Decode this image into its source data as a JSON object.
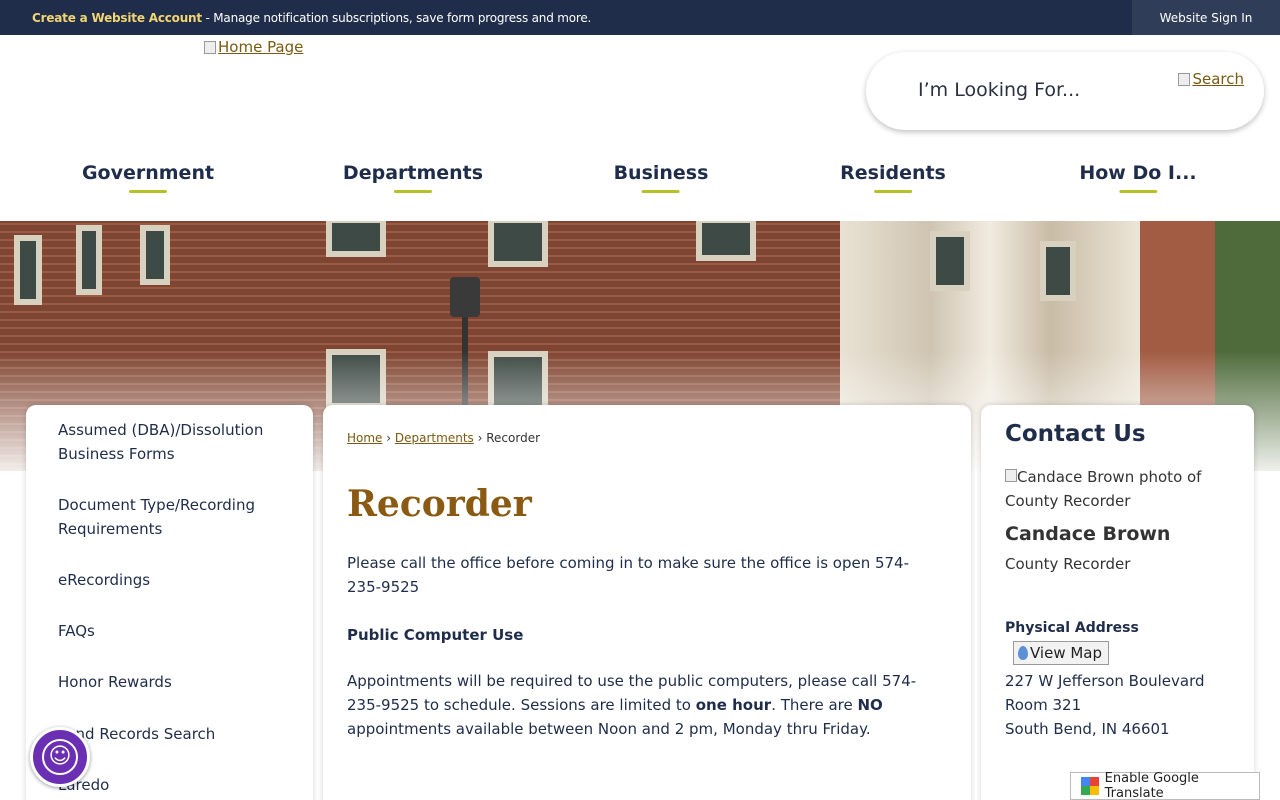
{
  "topbar": {
    "create_label": "Create a Website Account",
    "message": " - Manage notification subscriptions, save form progress and more.",
    "signin_label": "Website Sign In"
  },
  "header": {
    "home_link": "Home Page",
    "search_placeholder": "I’m Looking For...",
    "search_button": "Search"
  },
  "nav": {
    "items": [
      "Government",
      "Departments",
      "Business",
      "Residents",
      "How Do I..."
    ]
  },
  "sidebar": {
    "items": [
      "Assumed (DBA)/Dissolution Business Forms",
      "Document Type/Recording Requirements",
      "eRecordings",
      "FAQs",
      "Honor Rewards",
      "Land Records Search",
      "Laredo"
    ]
  },
  "breadcrumb": {
    "home": "Home",
    "departments": "Departments",
    "current": "Recorder",
    "sep": "›"
  },
  "main": {
    "title": "Recorder",
    "para1": "Please call the office before coming in to make sure the office is open 574-235-9525",
    "heading": "Public Computer Use",
    "para2_a": "Appointments will be required to use the public computers, please call 574-235-9525 to schedule. Sessions are limited to ",
    "para2_b": "one hour",
    "para2_c": ".  There are ",
    "para2_d": "NO",
    "para2_e": " appointments available between Noon and 2 pm, Monday thru Friday."
  },
  "contact": {
    "title": "Contact Us",
    "photo_alt": "Candace Brown photo of County Recorder",
    "name": "Candace Brown",
    "role": "County Recorder",
    "address_label": "Physical Address",
    "map_button": "View Map",
    "address_line1": "227 W Jefferson Boulevard",
    "address_line2": "Room 321",
    "address_line3": "South Bend, IN 46601"
  },
  "widgets": {
    "translate_label": "Enable Google Translate"
  },
  "colors": {
    "navy": "#1f2d4a",
    "gold_text": "#8a5a13",
    "nav_underline": "#b6c027",
    "accessibility": "#6b2fb3"
  }
}
